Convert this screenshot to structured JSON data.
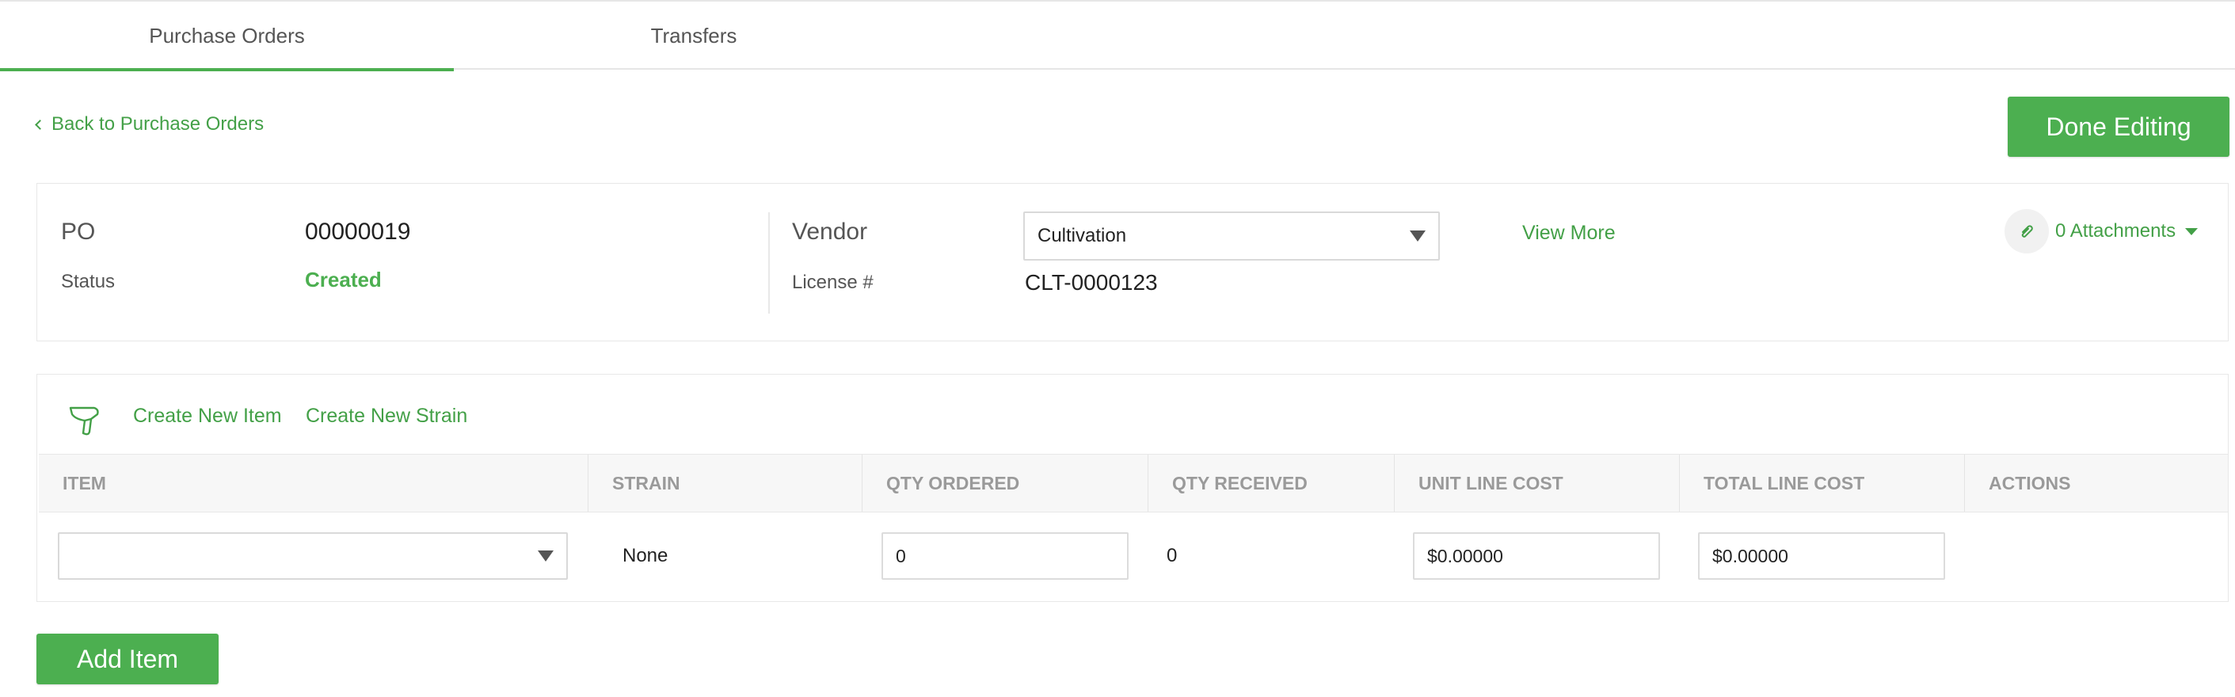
{
  "tabs": [
    {
      "label": "Purchase Orders",
      "active": true
    },
    {
      "label": "Transfers",
      "active": false
    }
  ],
  "back_link": {
    "label": "Back to Purchase Orders"
  },
  "done_button": {
    "label": "Done Editing"
  },
  "po_card": {
    "po_label": "PO",
    "po_value": "00000019",
    "status_label": "Status",
    "status_value": "Created",
    "vendor_label": "Vendor",
    "vendor_value": "Cultivation",
    "license_label": "License #",
    "license_value": "CLT-0000123",
    "view_more": "View More",
    "attachments": "0 Attachments"
  },
  "items_toolbar": {
    "create_item": "Create New Item",
    "create_strain": "Create New Strain"
  },
  "table": {
    "headers": [
      "ITEM",
      "STRAIN",
      "QTY ORDERED",
      "QTY RECEIVED",
      "UNIT LINE COST",
      "TOTAL LINE COST",
      "ACTIONS"
    ],
    "rows": [
      {
        "item": "",
        "strain": "None",
        "qty_ordered": "0",
        "qty_received": "0",
        "unit_line_cost": "$0.00000",
        "total_line_cost": "$0.00000"
      }
    ]
  },
  "add_item_button": {
    "label": "Add Item"
  },
  "colors": {
    "accent": "#4caf50",
    "link": "#43a047",
    "header_text": "#9a9a9a"
  },
  "icons": [
    "chevron-left-icon",
    "chevron-down-icon",
    "paperclip-icon",
    "barcode-scanner-icon"
  ]
}
